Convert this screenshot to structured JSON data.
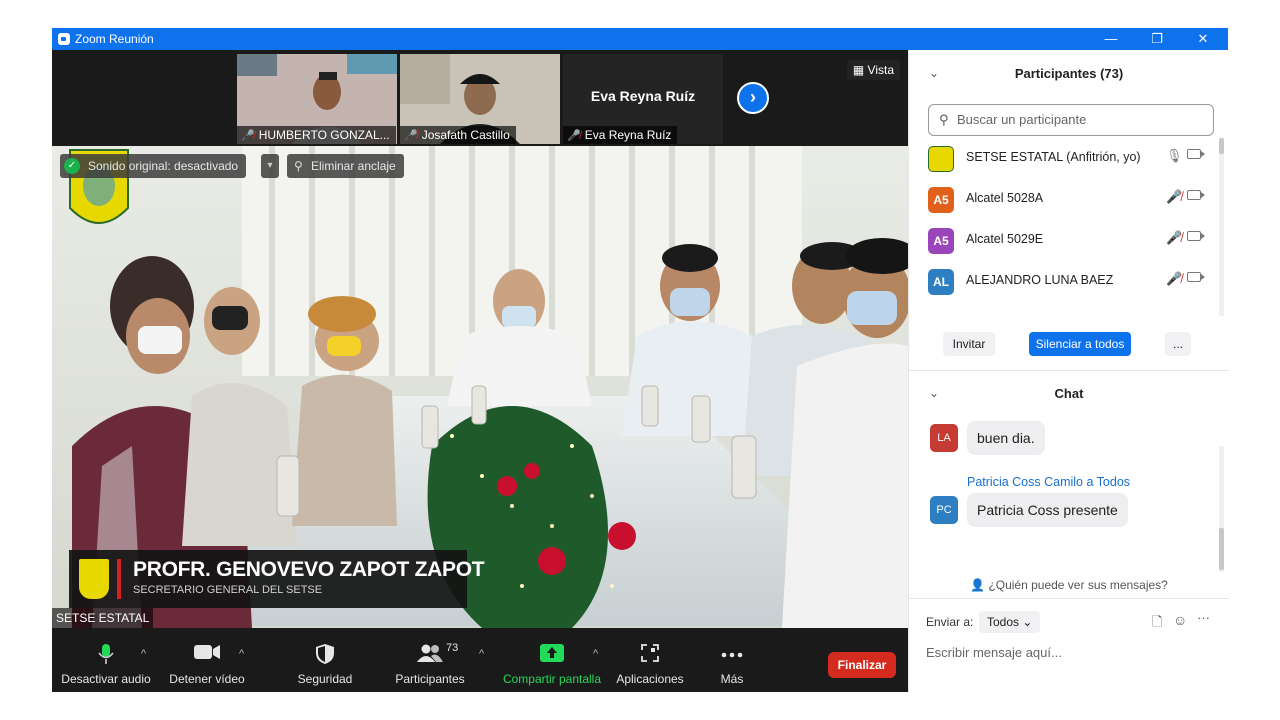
{
  "window": {
    "title": "Zoom Reunión",
    "controls": {
      "minimize": "—",
      "restore": "❐",
      "close": "✕"
    }
  },
  "video": {
    "view_label": "Vista",
    "thumbnails": [
      {
        "name": "HUMBERTO GONZAL...",
        "muted": true
      },
      {
        "name": "Josafath Castillo",
        "muted": true
      },
      {
        "name": "Eva Reyna Ruíz",
        "display_name": "Eva Reyna Ruíz",
        "muted": true
      }
    ],
    "original_sound": "Sonido original: desactivado",
    "unpin_label": "Eliminar anclaje",
    "lower_third": {
      "name": "PROFR. GENOVEVO ZAPOT ZAPOT",
      "role": "SECRETARIO GENERAL DEL SETSE"
    },
    "speaker_name": "SETSE ESTATAL"
  },
  "toolbar": {
    "items": [
      {
        "label": "Desactivar audio",
        "icon": "microphone-icon"
      },
      {
        "label": "Detener vídeo",
        "icon": "video-camera-icon"
      },
      {
        "label": "Seguridad",
        "icon": "shield-icon"
      },
      {
        "label": "Participantes",
        "icon": "participants-icon",
        "count": "73"
      },
      {
        "label": "Compartir pantalla",
        "icon": "share-screen-icon",
        "color": "#23d959"
      },
      {
        "label": "Aplicaciones",
        "icon": "apps-icon"
      },
      {
        "label": "Más",
        "icon": "more-icon"
      }
    ],
    "end_label": "Finalizar",
    "end_color": "#d52b1e"
  },
  "participants": {
    "header": "Participantes (73)",
    "search_placeholder": "Buscar un participante",
    "list": [
      {
        "name": "SETSE ESTATAL (Anfitrión, yo)",
        "avatar": "logo",
        "mic": "on"
      },
      {
        "name": "Alcatel 5028A",
        "initials": "A5",
        "color": "#e0601c",
        "mic": "off"
      },
      {
        "name": "Alcatel 5029E",
        "initials": "A5",
        "color": "#9a45b9",
        "mic": "off"
      },
      {
        "name": "ALEJANDRO LUNA BAEZ",
        "initials": "AL",
        "color": "#2d7fc1",
        "mic": "off"
      }
    ],
    "buttons": {
      "invite": "Invitar",
      "mute_all": "Silenciar a todos",
      "more": "..."
    }
  },
  "chat": {
    "header": "Chat",
    "messages": [
      {
        "initials": "LA",
        "color": "#c63b34",
        "text": "buen dia."
      },
      {
        "initials": "PC",
        "color": "#2d7fc1",
        "sender": "Patricia Coss Camilo a Todos",
        "text": "Patricia Coss presente"
      }
    ],
    "who_can_see": "¿Quién puede ver sus mensajes?",
    "send_to_label": "Enviar a:",
    "send_to_value": "Todos",
    "input_placeholder": "Escribir mensaje aquí..."
  }
}
